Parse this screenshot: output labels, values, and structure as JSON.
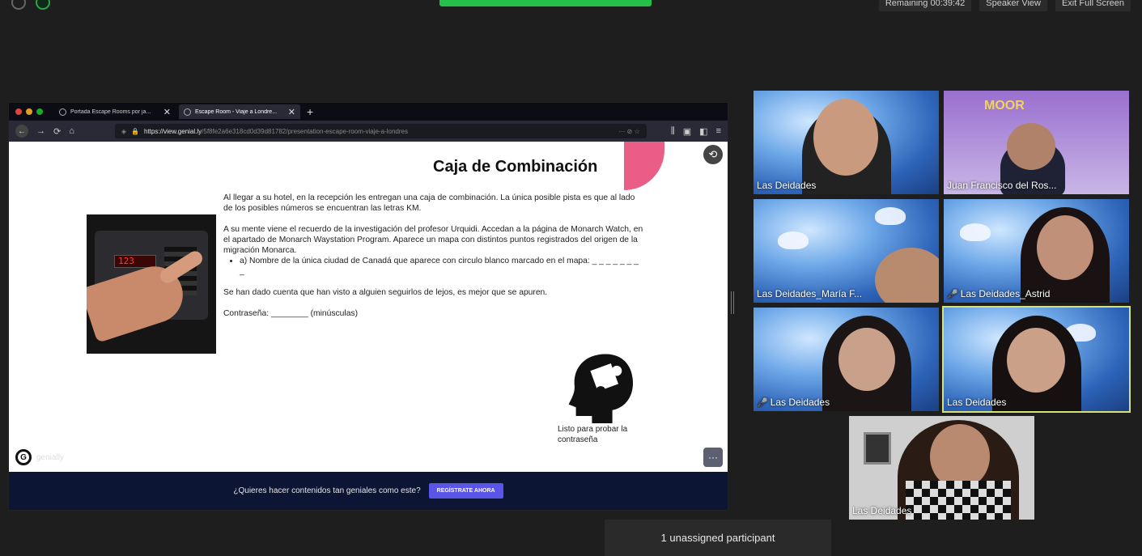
{
  "zoom": {
    "top_right": [
      "Remaining 00:39:42",
      "Speaker View",
      "Exit Full Screen"
    ],
    "unassigned": "1 unassigned participant"
  },
  "browser": {
    "tabs": [
      {
        "title": "Portada Escape Rooms por ja..."
      },
      {
        "title": "Escape Room - Viaje a Londre..."
      }
    ],
    "url_host": "https://view.genial.ly",
    "url_path": "/5f8fe2a6e318cd0d39d81782/presentation-escape-room-viaje-a-londres",
    "url_menu": "··· ⊘ ☆"
  },
  "slide": {
    "title": "Caja de Combinación",
    "paragraph1": "Al llegar a su hotel, en la recepción les entregan una caja de combinación. La única posible pista es que al lado de los posibles números se encuentran las letras KM.",
    "paragraph2": "A su mente viene el recuerdo de la investigación del profesor Urquidi. Accedan a la página de Monarch Watch, en el apartado de Monarch Waystation Program. Aparece un mapa con distintos puntos registrados del origen de la migración Monarca.",
    "bullet": "a) Nombre de la única ciudad de Canadá que aparece con circulo blanco marcado en el mapa: _ _ _ _ _ _ _ _",
    "paragraph3": "Se han dado cuenta que han visto a alguien seguirlos de lejos, es mejor que se apuren.",
    "password": "Contraseña: ________ (minúsculas)",
    "safe_display": "123",
    "ready": "Listo para probar la contraseña",
    "brand": "genially",
    "footer_question": "¿Quieres hacer contenidos tan geniales como este?",
    "footer_cta": "REGÍSTRATE AHORA"
  },
  "participants": [
    {
      "name": "Las Deidades",
      "muted": false
    },
    {
      "name": "Juan Francisco del Ros...",
      "muted": false
    },
    {
      "name": "Las Deidades_María F...",
      "muted": false
    },
    {
      "name": "Las Deidades_Astrid",
      "muted": true
    },
    {
      "name": "Las Deidades",
      "muted": true
    },
    {
      "name": "Las Deidades",
      "muted": false
    },
    {
      "name": "Las Deidades",
      "muted": false
    }
  ],
  "poster_title": "MOOR"
}
